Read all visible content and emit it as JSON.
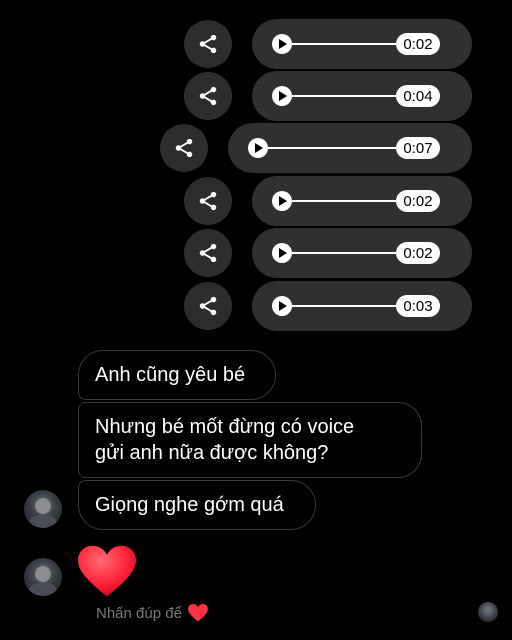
{
  "voice_messages": [
    {
      "duration": "0:02"
    },
    {
      "duration": "0:04"
    },
    {
      "duration": "0:07"
    },
    {
      "duration": "0:02"
    },
    {
      "duration": "0:02"
    },
    {
      "duration": "0:03"
    }
  ],
  "messages": [
    {
      "text": "Anh cũng yêu bé"
    },
    {
      "line1": "Nhưng bé mốt đừng có voice",
      "line2": "gửi anh nữa được không?"
    },
    {
      "text": "Giọng nghe gớm quá"
    }
  ],
  "reaction": {
    "emoji": "heart",
    "color": "#ff2a3d"
  },
  "hint": {
    "text": "Nhấn đúp để"
  },
  "colors": {
    "background": "#000000",
    "bubble": "#303032",
    "share_button": "#2d2d2f"
  }
}
